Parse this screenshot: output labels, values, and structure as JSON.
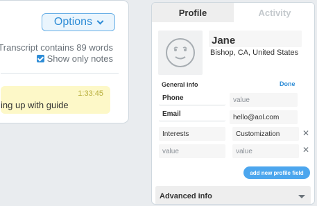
{
  "transcript": {
    "options_label": "Options",
    "word_count_text": "Transcript contains 89 words",
    "show_notes_label": "Show only notes",
    "show_notes_checked": true,
    "note": {
      "time": "1:33:45",
      "text": "ing up with guide"
    }
  },
  "profile_panel": {
    "tabs": [
      {
        "label": "Profile",
        "active": true
      },
      {
        "label": "Activity",
        "active": false
      }
    ],
    "avatar_icon": "smiley-face-icon",
    "name": "Jane",
    "location": "Bishop, CA, United States",
    "general_info_label": "General info",
    "done_label": "Done",
    "fields": {
      "phone_label": "Phone",
      "phone_placeholder": "value",
      "email_label": "Email",
      "email_value": "hello@aol.com",
      "custom1_key": "Interests",
      "custom1_value": "Customization",
      "custom2_key_placeholder": "value",
      "custom2_value_placeholder": "value"
    },
    "add_field_label": "add new profile field",
    "advanced_label": "Advanced info"
  },
  "colors": {
    "accent": "#2d8cd6",
    "note_bg": "#fdf8c8",
    "button_blue": "#4ca6ee"
  }
}
